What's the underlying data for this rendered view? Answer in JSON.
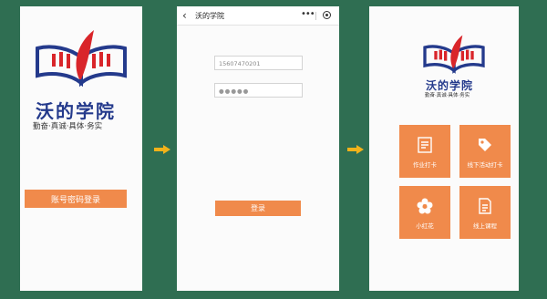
{
  "brand": {
    "name": "沃的学院",
    "slogan": "勤奋·真诚·具体·务实"
  },
  "screen1": {
    "login_button": "账号密码登录"
  },
  "screen2": {
    "nav_title": "沃的学院",
    "more_label": "•••",
    "phone_value": "15607470201",
    "password_mask": "●●●●●",
    "login_button": "登录"
  },
  "screen3": {
    "tiles": [
      {
        "label": "作业打卡",
        "icon": "clipboard-icon"
      },
      {
        "label": "线下活动打卡",
        "icon": "tag-icon"
      },
      {
        "label": "小红花",
        "icon": "flower-icon"
      },
      {
        "label": "线上课程",
        "icon": "document-icon"
      }
    ]
  },
  "colors": {
    "background": "#2f6e52",
    "accent": "#f08a4b",
    "arrow": "#f2b21a",
    "brand_blue": "#243a8c",
    "brand_red": "#d9252a"
  }
}
